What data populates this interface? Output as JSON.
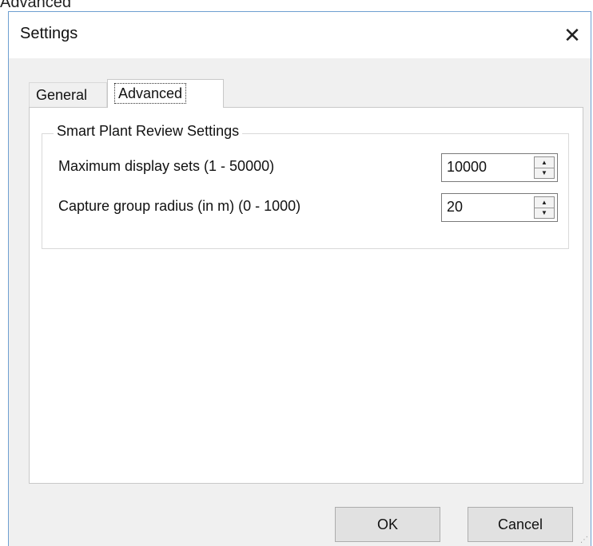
{
  "background_window": {
    "text": "Advanced"
  },
  "dialog": {
    "title": "Settings",
    "close_icon": "✕",
    "tabs": [
      {
        "label": "General",
        "selected": false
      },
      {
        "label": "Advanced",
        "selected": true
      }
    ],
    "group": {
      "title": "Smart Plant Review Settings",
      "fields": [
        {
          "label": "Maximum display sets (1 - 50000)",
          "value": "10000"
        },
        {
          "label": "Capture group radius (in m) (0 - 1000)",
          "value": "20"
        }
      ]
    },
    "buttons": {
      "ok": "OK",
      "cancel": "Cancel"
    }
  },
  "icons": {
    "spin_up": "▲",
    "spin_down": "▼",
    "resize_grip": "⋰"
  },
  "colors": {
    "window_border": "#6e9fd1",
    "dialog_background": "#f0f0f0",
    "panel_background": "#ffffff"
  }
}
